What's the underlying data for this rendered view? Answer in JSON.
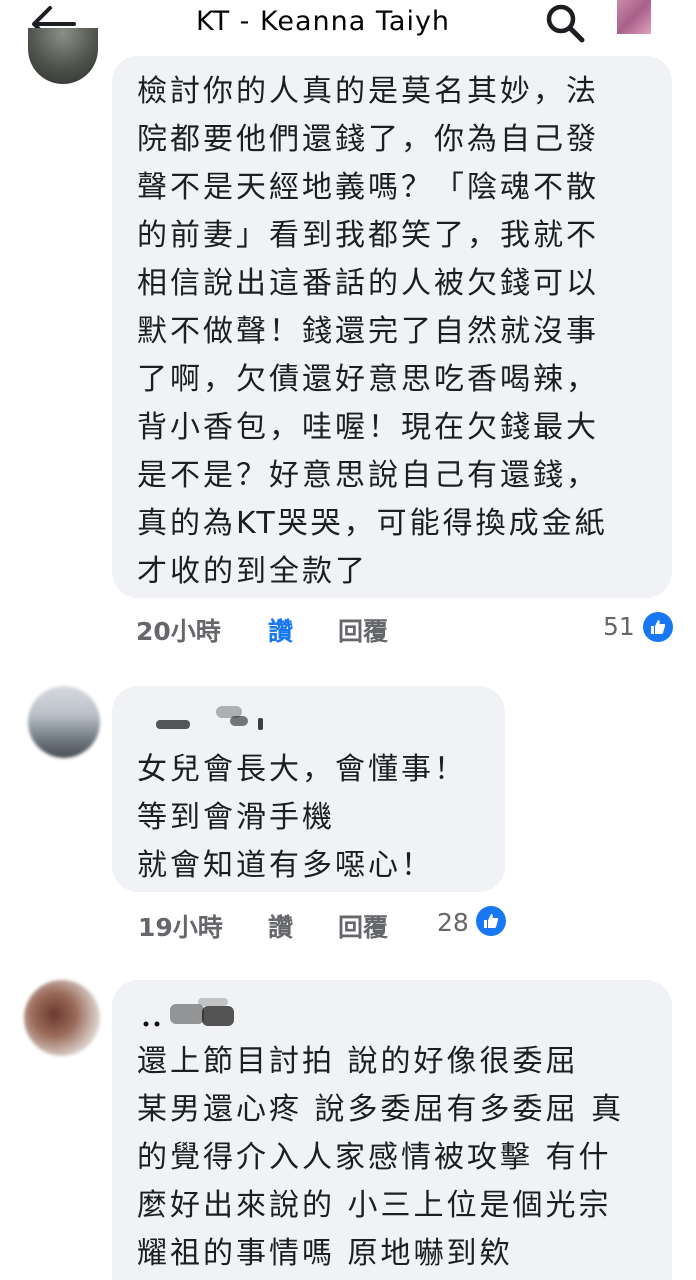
{
  "header": {
    "title": "KT - Keanna Taiyh"
  },
  "comments": [
    {
      "text": "檢討你的人真的是莫名其妙，法\n院都要他們還錢了，你為自己發\n聲不是天經地義嗎？「陰魂不散\n的前妻」看到我都笑了，我就不\n相信說出這番話的人被欠錢可以\n默不做聲！錢還完了自然就沒事\n了啊，欠債還好意思吃香喝辣，\n背小香包，哇喔！現在欠錢最大\n是不是？好意思說自己有還錢，\n真的為KT哭哭，可能得換成金紙\n才收的到全款了",
      "time": "20小時",
      "like_label": "讚",
      "reply_label": "回覆",
      "likes": "51"
    },
    {
      "text": "女兒會長大，會懂事！\n等到會滑手機\n就會知道有多噁心！",
      "time": "19小時",
      "like_label": "讚",
      "reply_label": "回覆",
      "likes": "28"
    },
    {
      "text": "還上節目討拍  說的好像很委屈\n某男還心疼 說多委屈有多委屈 真\n的覺得介入人家感情被攻擊 有什\n麼好出來說的 小三上位是個光宗\n耀祖的事情嗎 原地嚇到欸"
    }
  ],
  "colors": {
    "bubble": "#f0f2f5",
    "accent": "#1877f2",
    "meta": "#65676b"
  }
}
